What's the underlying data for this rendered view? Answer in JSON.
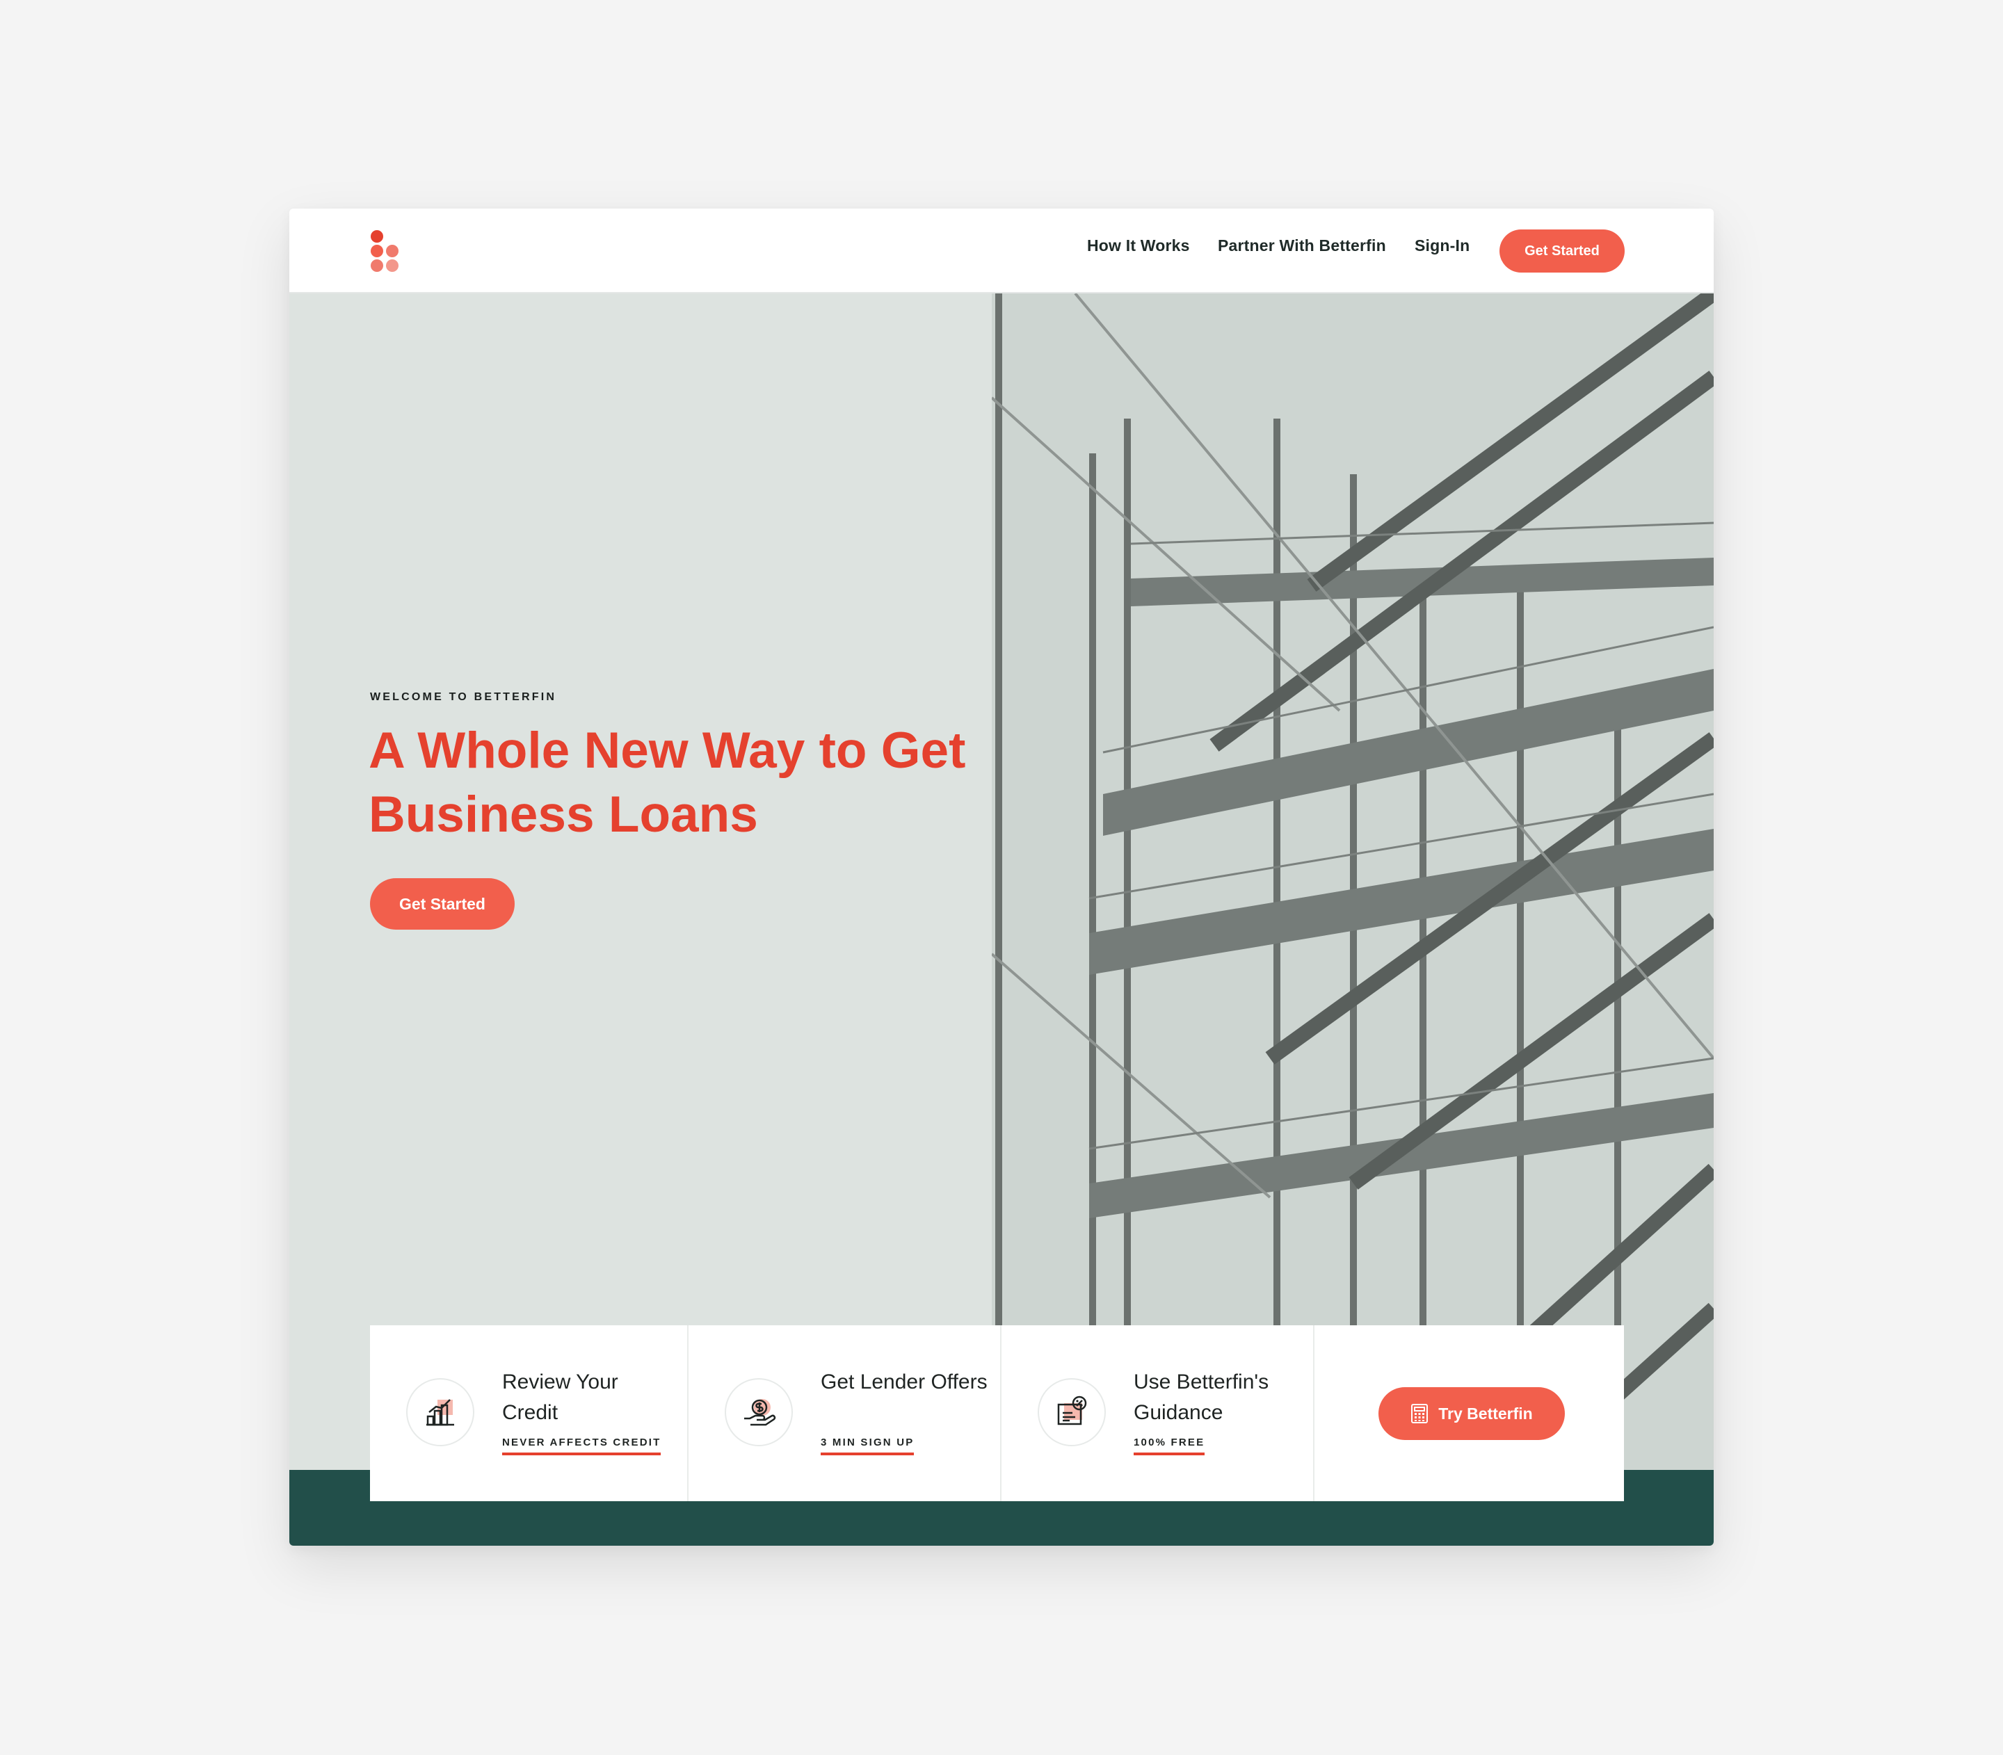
{
  "colors": {
    "accent": "#f25f4c",
    "headline": "#e5412e",
    "hero_bg": "#dde3e0",
    "band": "#224f4a"
  },
  "header": {
    "logo": "betterfin-dots-logo",
    "nav": [
      "How It Works",
      "Partner With Betterfin",
      "Sign-In"
    ],
    "cta": "Get Started"
  },
  "hero": {
    "eyebrow": "WELCOME TO BETTERFIN",
    "headline_line1": "A Whole New Way to Get",
    "headline_line2": "Business Loans",
    "cta": "Get Started",
    "image": "steel-staircase-structure"
  },
  "steps": [
    {
      "icon": "credit-chart-icon",
      "title": "Review Your Credit",
      "tag": "NEVER AFFECTS CREDIT"
    },
    {
      "icon": "hand-coin-icon",
      "title": "Get Lender Offers",
      "tag": "3 MIN SIGN UP"
    },
    {
      "icon": "document-percent-icon",
      "title": "Use Betterfin's Guidance",
      "tag": "100% FREE"
    }
  ],
  "try_cta": {
    "label": "Try Betterfin",
    "icon": "calculator-icon"
  }
}
